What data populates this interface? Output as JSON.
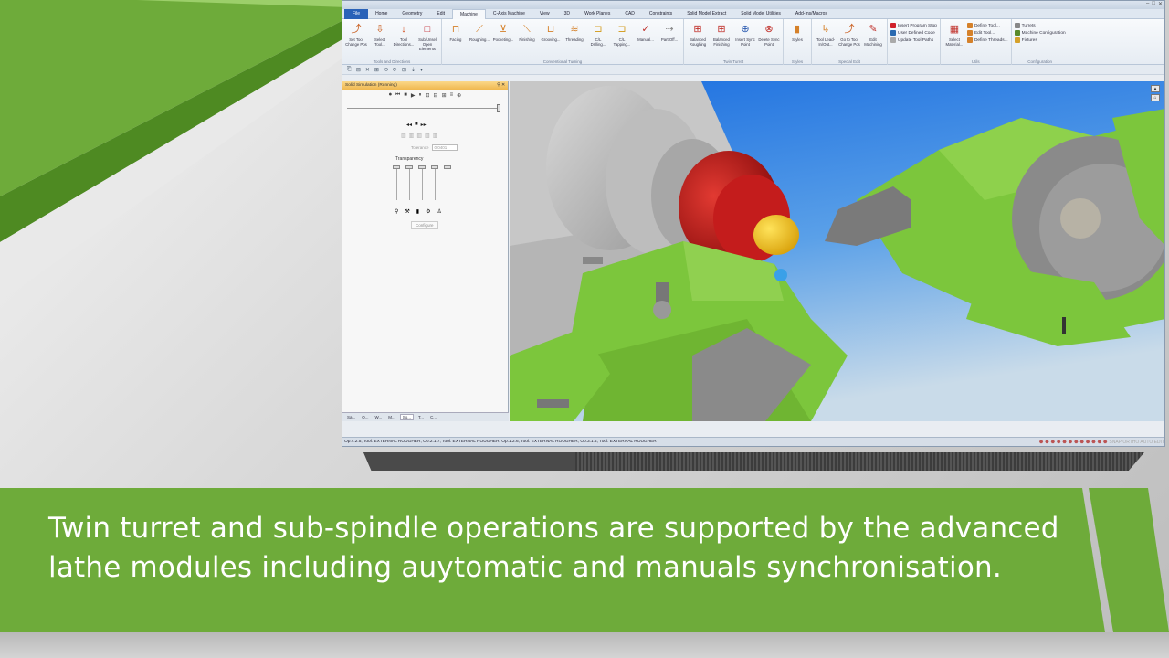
{
  "window": {
    "title": "",
    "controls": [
      "–",
      "□",
      "✕"
    ]
  },
  "ribbon_tabs": [
    {
      "label": "File",
      "kind": "file"
    },
    {
      "label": "Home"
    },
    {
      "label": "Geometry"
    },
    {
      "label": "Edit"
    },
    {
      "label": "Machine",
      "active": true
    },
    {
      "label": "C-Axis Machine"
    },
    {
      "label": "View"
    },
    {
      "label": "3D"
    },
    {
      "label": "Work Planes"
    },
    {
      "label": "CAD"
    },
    {
      "label": "Constraints"
    },
    {
      "label": "Solid Model Extract"
    },
    {
      "label": "Solid Model Utilities"
    },
    {
      "label": "Add-Ins/Macros"
    }
  ],
  "ribbon_groups": [
    {
      "label": "Tools and Directions",
      "buttons": [
        {
          "label": "Set Tool Change Pos",
          "icon": "tool-change-icon",
          "glyph": "⤴",
          "color": "#c85a1a"
        },
        {
          "label": "Select Tool...",
          "icon": "select-tool-icon",
          "glyph": "⇩",
          "color": "#c85a1a"
        },
        {
          "label": "Tool Directions...",
          "icon": "tool-direction-icon",
          "glyph": "↓",
          "color": "#d24a1a"
        },
        {
          "label": "Sub/Unsel Open Elements",
          "icon": "open-elements-icon",
          "glyph": "□",
          "color": "#c0202a"
        }
      ]
    },
    {
      "label": "Conventional Turning",
      "buttons": [
        {
          "label": "Facing",
          "icon": "facing-icon",
          "glyph": "⊓",
          "color": "#d5812a"
        },
        {
          "label": "Roughing...",
          "icon": "roughing-icon",
          "glyph": "⟋",
          "color": "#d5812a"
        },
        {
          "label": "Pocketing...",
          "icon": "pocketing-icon",
          "glyph": "⊻",
          "color": "#d5812a"
        },
        {
          "label": "Finishing",
          "icon": "finishing-icon",
          "glyph": "⟍",
          "color": "#d5812a"
        },
        {
          "label": "Grooving...",
          "icon": "grooving-icon",
          "glyph": "⊔",
          "color": "#d5812a"
        },
        {
          "label": "Threading",
          "icon": "threading-icon",
          "glyph": "≋",
          "color": "#d5812a"
        },
        {
          "label": "C/L Drilling...",
          "icon": "drilling-icon",
          "glyph": "⊐",
          "color": "#d5a12a"
        },
        {
          "label": "C/L Tapping...",
          "icon": "tapping-icon",
          "glyph": "⊐",
          "color": "#d5a12a"
        },
        {
          "label": "Manual...",
          "icon": "manual-icon",
          "glyph": "✓",
          "color": "#c0302a"
        },
        {
          "label": "Part Off...",
          "icon": "part-off-icon",
          "glyph": "⇢",
          "color": "#888"
        }
      ]
    },
    {
      "label": "Twin Turret",
      "buttons": [
        {
          "label": "Balanced Roughing",
          "icon": "balanced-roughing-icon",
          "glyph": "⊞",
          "color": "#c0302a"
        },
        {
          "label": "Balanced Finishing",
          "icon": "balanced-finishing-icon",
          "glyph": "⊞",
          "color": "#c0302a"
        },
        {
          "label": "Insert Sync Point",
          "icon": "insert-sync-icon",
          "glyph": "⊕",
          "color": "#2a5ab0"
        },
        {
          "label": "Delete Sync Point",
          "icon": "delete-sync-icon",
          "glyph": "⊗",
          "color": "#c0302a"
        }
      ]
    },
    {
      "label": "Styles",
      "buttons": [
        {
          "label": "Styles",
          "icon": "styles-icon",
          "glyph": "▮",
          "color": "#d5812a"
        }
      ]
    },
    {
      "label": "Special Edit",
      "buttons": [
        {
          "label": "Tool Lead-In/Out...",
          "icon": "lead-in-icon",
          "glyph": "↳",
          "color": "#d5812a"
        },
        {
          "label": "Go to Tool Change Pos",
          "icon": "goto-tool-change-icon",
          "glyph": "⤴",
          "color": "#c85a1a"
        },
        {
          "label": "Edit Machining",
          "icon": "edit-machining-icon",
          "glyph": "✎",
          "color": "#c0302a"
        }
      ]
    }
  ],
  "ribbon_small_groups": [
    {
      "label": "",
      "items": [
        {
          "label": "Insert Program Stop",
          "icon": "program-stop-icon",
          "color": "#d0202a"
        },
        {
          "label": "User Defined Code",
          "icon": "user-code-icon",
          "color": "#2a6ab0"
        },
        {
          "label": "Update Tool Paths",
          "icon": "update-paths-icon",
          "color": "#aaaaaa"
        }
      ]
    },
    {
      "label": "Utils",
      "lead_button": {
        "label": "Select Material...",
        "icon": "select-material-icon",
        "glyph": "▦",
        "color": "#c0302a"
      },
      "items": [
        {
          "label": "Define Tool...",
          "icon": "define-tool-icon",
          "color": "#d5812a"
        },
        {
          "label": "Edit Tool...",
          "icon": "edit-tool-icon",
          "color": "#d5812a"
        },
        {
          "label": "Define Threads...",
          "icon": "define-threads-icon",
          "color": "#d5812a"
        }
      ]
    },
    {
      "label": "Configuration",
      "items": [
        {
          "label": "Turrets",
          "icon": "turrets-icon",
          "color": "#888"
        },
        {
          "label": "Machine Configuration",
          "icon": "machine-config-icon",
          "color": "#5a8a2a"
        },
        {
          "label": "Fixtures",
          "icon": "fixtures-icon",
          "color": "#d5a12a"
        }
      ]
    }
  ],
  "quick_access": [
    "⎘",
    "⊟",
    "✕",
    "⊞",
    "⟲",
    "⟳",
    "⊡",
    "⇣",
    "▾"
  ],
  "sim_panel": {
    "title": "Solid Simulation (Running)",
    "pin": "⚲ ✕",
    "top_controls": [
      "⏺",
      "⏮",
      "■",
      "▶",
      "⏸",
      "⊡",
      "⊟",
      "⊞",
      "≡",
      "⊕"
    ],
    "play_controls": [
      "◂◂",
      "■",
      "▸▸"
    ],
    "grey_icons": [
      "▥",
      "▥",
      "▥",
      "▥",
      "▥"
    ],
    "tolerance_label": "Tolerance",
    "tolerance_value": "0.0401",
    "transparency_label": "Transparency",
    "tool_icons": [
      "⚲",
      "⚒",
      "▮",
      "⚙",
      "♙"
    ],
    "configure_label": "Configure",
    "tabs": [
      {
        "label": "Sa..."
      },
      {
        "label": "O..."
      },
      {
        "label": "W..."
      },
      {
        "label": "M..."
      },
      {
        "label": "So...",
        "active": true
      },
      {
        "label": "T..."
      },
      {
        "label": "C..."
      }
    ]
  },
  "status": {
    "text": "Op.4.2.5, Tool: EXTERNAL ROUGHER, Op.2.1.7, Tool: EXTERNAL ROUGHER, Op.1.2.6, Tool: EXTERNAL ROUGHER, Op.3.1.4, Tool: EXTERNAL ROUGHER",
    "right_labels": "SNAP  ORTHO  AUTO  EDIT"
  },
  "caption": {
    "text": "Twin turret and sub-spindle operations are supported by the advanced lathe modules including auytomatic and manuals synchronisation."
  },
  "colors": {
    "brand_green": "#6eab3a",
    "machine_green": "#7cc63c",
    "part_red": "#b81416",
    "part_yellow": "#f0c419",
    "sky_blue": "#2a7be0"
  }
}
